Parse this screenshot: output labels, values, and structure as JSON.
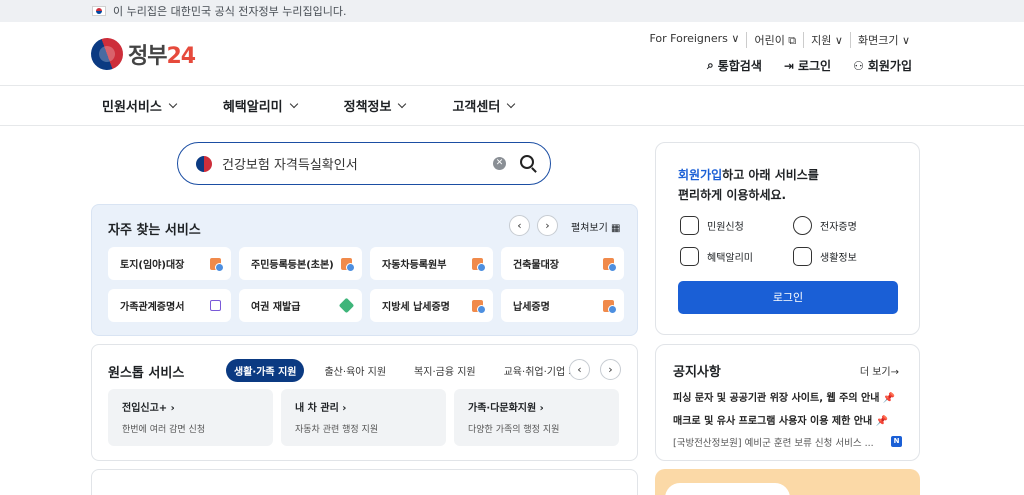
{
  "topbar": {
    "notice": "이 누리집은 대한민국 공식 전자정부 누리집입니다."
  },
  "logo": {
    "text": "정부",
    "num": "24"
  },
  "utilnav": [
    "For Foreigners ∨",
    "어린이 ⧉",
    "지원 ∨",
    "화면크기 ∨"
  ],
  "actions": {
    "search": "통합검색",
    "login": "로그인",
    "signup": "회원가입"
  },
  "nav": [
    "민원서비스",
    "혜택알리미",
    "정책정보",
    "고객센터"
  ],
  "search": {
    "value": "건강보험 자격득실확인서"
  },
  "frequent": {
    "title": "자주 찾는 서비스",
    "expand": "펼쳐보기",
    "items": [
      {
        "label": "토지(임야)대장",
        "icon": "document-icon"
      },
      {
        "label": "주민등록등본(초본)",
        "icon": "document-icon"
      },
      {
        "label": "자동차등록원부",
        "icon": "document-icon"
      },
      {
        "label": "건축물대장",
        "icon": "document-icon"
      },
      {
        "label": "가족관계증명서",
        "icon": "external-link-icon"
      },
      {
        "label": "여권 재발급",
        "icon": "pen-icon"
      },
      {
        "label": "지방세 납세증명",
        "icon": "document-icon"
      },
      {
        "label": "납세증명",
        "icon": "document-icon"
      }
    ]
  },
  "onestop": {
    "title": "원스톱 서비스",
    "tabs": [
      "생활·가족 지원",
      "출산·육아 지원",
      "복지·금융 지원",
      "교육·취업·기업 지원"
    ],
    "cards": [
      {
        "title": "전입신고+",
        "desc": "한번에 여러 감면 신청"
      },
      {
        "title": "내 차 관리",
        "desc": "자동차 관련 행정 지원"
      },
      {
        "title": "가족·다문화지원",
        "desc": "다양한 가족의 행정 지원"
      }
    ]
  },
  "loginbox": {
    "msg_hl": "회원가입",
    "msg_rest": "하고 아래 서비스를",
    "msg_line2": "편리하게 이용하세요.",
    "services": [
      "민원신청",
      "전자증명",
      "혜택알리미",
      "생활정보"
    ],
    "button": "로그인"
  },
  "notice": {
    "title": "공지사항",
    "more": "더 보기→",
    "items": [
      "피싱 문자 및 공공기관 위장 사이트, 웹 주의 안내 📌",
      "매크로 및 유사 프로그램 사용자 이용 제한 안내 📌",
      "[국방전산정보원] 예비군 훈련 보류 신청 서비스 ..."
    ],
    "badge": "N"
  },
  "colors": {
    "primary": "#1a5fd6",
    "navy": "#0b3a82",
    "freq_bg": "#eaf1fa"
  }
}
